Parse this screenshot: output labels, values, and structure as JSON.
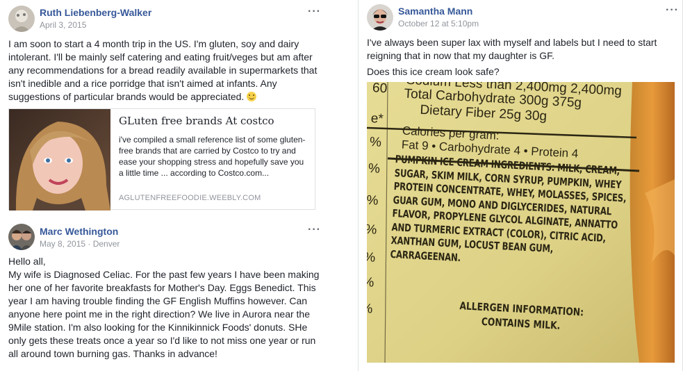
{
  "posts": {
    "ruth": {
      "author": "Ruth Liebenberg-Walker",
      "date": "April 3, 2015",
      "more_label": "···",
      "text": "I am soon to start a 4 month trip in the US. I'm gluten, soy and dairy intolerant. I'll be mainly self catering and eating fruit/veges but am after any recommendations for a bread readily available in supermarkets that isn't inedible and a rice porridge that isn't aimed at infants. Any suggestions of particular brands would be appreciated.",
      "emoji_icon": "smile-emoji",
      "link": {
        "title": "GLuten free brands At costco",
        "description": "i've compiled a small reference list of some gluten-free brands that are carried by Costco to try and ease your shopping stress and hopefully save you a little time ... according to Costco.com...",
        "domain": "AGLUTENFREEFOODIE.WEEBLY.COM"
      }
    },
    "marc": {
      "author": "Marc Wethington",
      "date": "May 8, 2015 · Denver",
      "more_label": "···",
      "greeting": "Hello all,",
      "text": "My wife is Diagnosed Celiac. For the past few years I have been making her one of her favorite breakfasts for Mother's Day. Eggs Benedict. This year I am having trouble finding the GF English Muffins however. Can anyone here point me in the right direction? We live in Aurora near the 9Mile station. I'm also looking for the Kinnikinnick Foods' donuts. SHe only gets these treats once a year so I'd like to not miss one year or run all around town burning gas. Thanks in advance!"
    },
    "samantha": {
      "author": "Samantha Mann",
      "date": "October 12 at 5:10pm",
      "more_label": "···",
      "text1": "I've always been super lax with myself and labels but I need to start reigning that in now that my daughter is GF.",
      "text2": "Does this ice cream look safe?",
      "photo": {
        "sodium_row": "Sodium        Less than  2,400mg  2,400mg",
        "carb_row": "Total Carbohydrate      300g      375g",
        "fiber_row": "Dietary Fiber            25g        30g",
        "calories_head": "Calories per gram:",
        "calories_row": "Fat 9  •  Carbohydrate 4  •  Protein 4",
        "ingredients": "PUMPKIN ICE CREAM INGREDIENTS: MILK, CREAM, SUGAR, SKIM MILK, CORN SYRUP, PUMPKIN, WHEY PROTEIN CONCENTRATE, WHEY, MOLASSES, SPICES, GUAR GUM, MONO AND DIGLYCERIDES, NATURAL FLAVOR, PROPYLENE GLYCOL ALGINATE, ANNATTO AND TURMERIC EXTRACT (COLOR), CITRIC ACID, XANTHAN GUM, LOCUST BEAN GUM, CARRAGEENAN.",
        "allergen_title": "ALLERGEN INFORMATION:",
        "allergen_text": "CONTAINS MILK.",
        "side_60": "60",
        "side_e": "e*",
        "side_pct": "%"
      }
    }
  },
  "colors": {
    "author_link": "#365899",
    "meta_gray": "#90949c",
    "label_yellow": "#e9df9c",
    "label_orange": "#e08a2c"
  }
}
